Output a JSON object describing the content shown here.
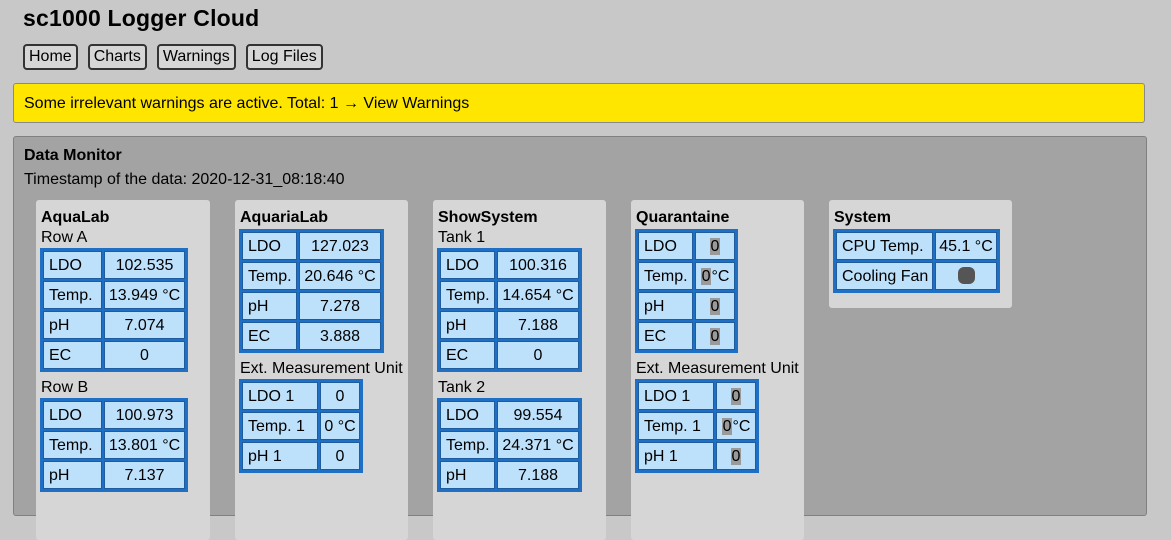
{
  "app": {
    "title": "sc1000 Logger Cloud"
  },
  "nav": [
    "Home",
    "Charts",
    "Warnings",
    "Log Files"
  ],
  "warning": {
    "text": "Some irrelevant warnings are active. Total: 1",
    "link": "→ View Warnings",
    "color": "#ffe600"
  },
  "monitor": {
    "title": "Data Monitor",
    "timestamp": "Timestamp of the data: 2020-12-31_08:18:40"
  },
  "panels": {
    "aqualab": {
      "title": "AquaLab",
      "groups": [
        {
          "label": "Row A",
          "rows": [
            [
              "LDO",
              "102.535"
            ],
            [
              "Temp.",
              "13.949 °C"
            ],
            [
              "pH",
              "7.074"
            ],
            [
              "EC",
              "0"
            ]
          ]
        },
        {
          "label": "Row B",
          "rows": [
            [
              "LDO",
              "100.973"
            ],
            [
              "Temp.",
              "13.801 °C"
            ],
            [
              "pH",
              "7.137"
            ]
          ]
        }
      ]
    },
    "aquarialab": {
      "title": "AquariaLab",
      "rows": [
        [
          "LDO",
          "127.023"
        ],
        [
          "Temp.",
          "20.646 °C"
        ],
        [
          "pH",
          "7.278"
        ],
        [
          "EC",
          "3.888"
        ]
      ],
      "ext_label": "Ext. Measurement Unit",
      "ext_rows": [
        [
          "LDO 1",
          "0"
        ],
        [
          "Temp. 1",
          "0 °C"
        ],
        [
          "pH 1",
          "0"
        ]
      ]
    },
    "showsystem": {
      "title": "ShowSystem",
      "groups": [
        {
          "label": "Tank 1",
          "rows": [
            [
              "LDO",
              "100.316"
            ],
            [
              "Temp.",
              "14.654 °C"
            ],
            [
              "pH",
              "7.188"
            ],
            [
              "EC",
              "0"
            ]
          ]
        },
        {
          "label": "Tank 2",
          "rows": [
            [
              "LDO",
              "99.554"
            ],
            [
              "Temp.",
              "24.371 °C"
            ],
            [
              "pH",
              "7.188"
            ]
          ]
        }
      ]
    },
    "quarantaine": {
      "title": "Quarantaine",
      "rows": [
        [
          "LDO",
          "0"
        ],
        [
          "Temp.",
          "0"
        ],
        [
          "pH",
          "0"
        ],
        [
          "EC",
          "0"
        ]
      ],
      "temp_unit": "°C",
      "ext_label": "Ext. Measurement Unit",
      "ext_rows": [
        [
          "LDO 1",
          "0"
        ],
        [
          "Temp. 1",
          "0"
        ],
        [
          "pH 1",
          "0"
        ]
      ]
    },
    "system": {
      "title": "System",
      "cpu_label": "CPU Temp.",
      "cpu_value": "45.1 °C",
      "fan_label": "Cooling Fan",
      "fan_icon": "fan-status-icon"
    }
  }
}
